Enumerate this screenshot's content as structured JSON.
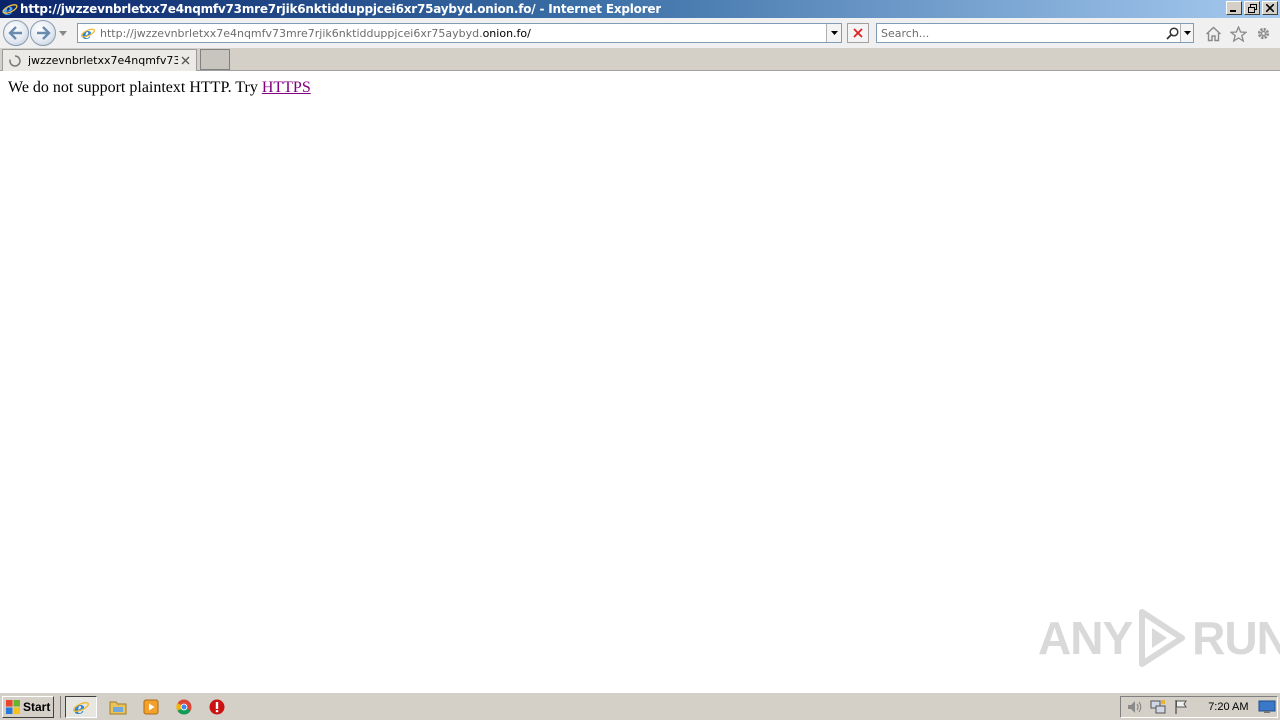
{
  "window": {
    "title": "http://jwzzevnbrletxx7e4nqmfv73mre7rjik6nktidduppjcei6xr75aybyd.onion.fo/ - Internet Explorer"
  },
  "navbar": {
    "address_prefix": "http://jwzzevnbrletxx7e4nqmfv73mre7rjik6nktidduppjcei6xr75aybyd.",
    "address_domain": "onion.fo/",
    "search_placeholder": "Search..."
  },
  "tabs": [
    {
      "label": "jwzzevnbrletxx7e4nqmfv73..."
    }
  ],
  "content": {
    "message_text": "We do not support plaintext HTTP. Try ",
    "link_text": "HTTPS"
  },
  "watermark": {
    "left": "ANY",
    "right": "RUN"
  },
  "taskbar": {
    "start_label": "Start",
    "clock": "7:20 AM"
  },
  "colors": {
    "link_visited": "#800080",
    "titlebar_start": "#0a246a",
    "titlebar_end": "#a6caf0",
    "chrome_gray": "#d4d0c8"
  }
}
